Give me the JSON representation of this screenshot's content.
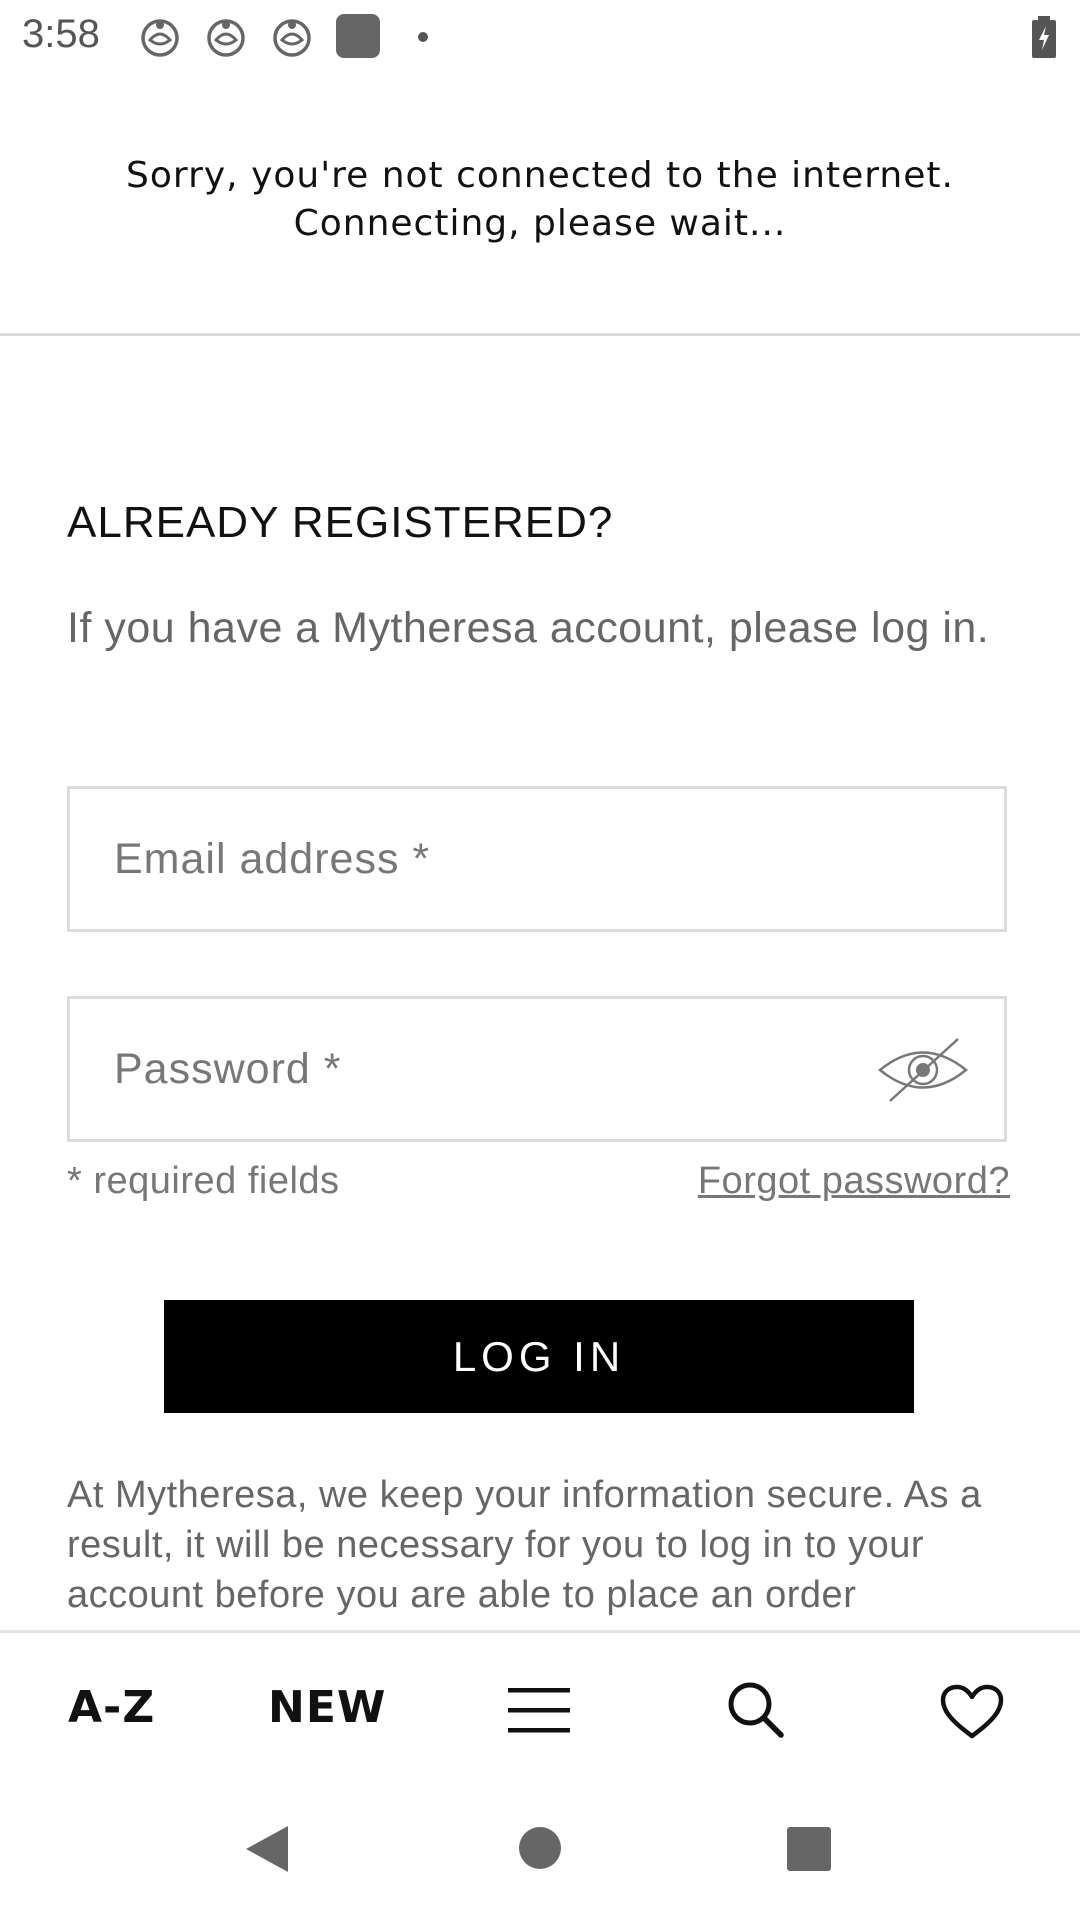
{
  "status_bar": {
    "time": "3:58",
    "icons": [
      "notification-icon",
      "notification-icon",
      "notification-icon",
      "app-square-icon",
      "dot-icon",
      "battery-charging-icon"
    ]
  },
  "banner": {
    "line1": "Sorry, you're not connected to the internet.",
    "line2": "Connecting, please wait..."
  },
  "login": {
    "heading": "ALREADY REGISTERED?",
    "description": "If you have a Mytheresa account, please log in.",
    "email_placeholder": "Email address *",
    "password_placeholder": "Password *",
    "required_note": "* required fields",
    "forgot_label": "Forgot password?",
    "button_label": "LOG IN",
    "info": "At Mytheresa, we keep your information secure. As a result, it will be necessary for you to log in to your account before you are able to place an order"
  },
  "bottom_nav": {
    "az_label": "A-Z",
    "new_label": "NEW",
    "icons": [
      "menu-icon",
      "search-icon",
      "heart-icon"
    ]
  },
  "system_nav": {
    "icons": [
      "back-icon",
      "home-icon",
      "recents-icon"
    ]
  },
  "colors": {
    "accent": "#000000",
    "text_muted": "#666666",
    "border": "#dcdcdc"
  }
}
